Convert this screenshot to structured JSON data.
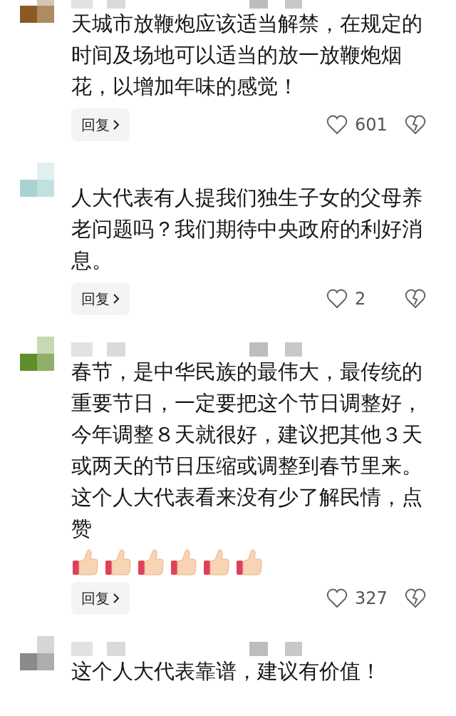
{
  "comments": [
    {
      "avatar": {
        "color": "#8a5a22"
      },
      "name_redacted": true,
      "text": "天城市放鞭炮应该适当解禁，在规定的时间及场地可以适当的放一放鞭炮烟花，以增加年味的感觉！",
      "reply": "回复",
      "likes": "601"
    },
    {
      "avatar": {
        "color": "#a9d3d3"
      },
      "name_redacted": false,
      "text": "人大代表有人提我们独生子女的父母养老问题吗？我们期待中央政府的利好消息。",
      "reply": "回复",
      "likes": "2"
    },
    {
      "avatar": {
        "color": "#5e8f2a"
      },
      "name_redacted": true,
      "text": "春节，是中华民族的最伟大，最传统的重要节日，一定要把这个节日调整好，今年调整８天就很好，建议把其他３天或两天的节日压缩或调整到春节里来。这个人大代表看来没有少了解民情，点赞",
      "inline_icons": [
        {
          "kind": "thumbs-up"
        },
        {
          "kind": "thumbs-up"
        },
        {
          "kind": "thumbs-up"
        },
        {
          "kind": "thumbs-up"
        },
        {
          "kind": "thumbs-up"
        },
        {
          "kind": "thumbs-up"
        }
      ],
      "reply": "回复",
      "likes": "327"
    },
    {
      "avatar": {
        "color": "#8c8a88"
      },
      "name_redacted": true,
      "text": "这个人大代表靠谱，建议有价值！"
    }
  ]
}
